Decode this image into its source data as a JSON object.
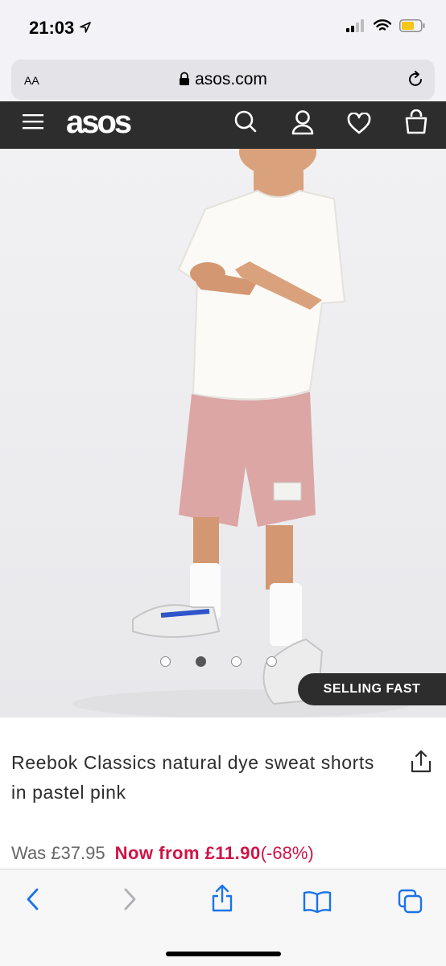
{
  "status_bar": {
    "time": "21:03"
  },
  "url_bar": {
    "text_size_label": "AA",
    "domain": "asos.com"
  },
  "header": {
    "logo": "asos"
  },
  "product": {
    "badge": "SELLING FAST",
    "title": "Reebok Classics natural dye sweat shorts in pastel pink",
    "price_was": "Was £37.95",
    "price_now": "Now from £11.90",
    "discount": "(-68%)",
    "carousel": {
      "count": 4,
      "active_index": 1
    }
  },
  "colors": {
    "header_bg": "#2d2d2d",
    "sale_red": "#d01345",
    "safari_blue": "#1a73e8"
  },
  "icons": [
    "location-arrow-icon",
    "signal-icon",
    "wifi-icon",
    "battery-icon",
    "lock-icon",
    "reload-icon",
    "menu-icon",
    "search-icon",
    "account-icon",
    "heart-icon",
    "bag-icon",
    "share-icon",
    "back-icon",
    "forward-icon",
    "bookmarks-icon",
    "tabs-icon"
  ]
}
